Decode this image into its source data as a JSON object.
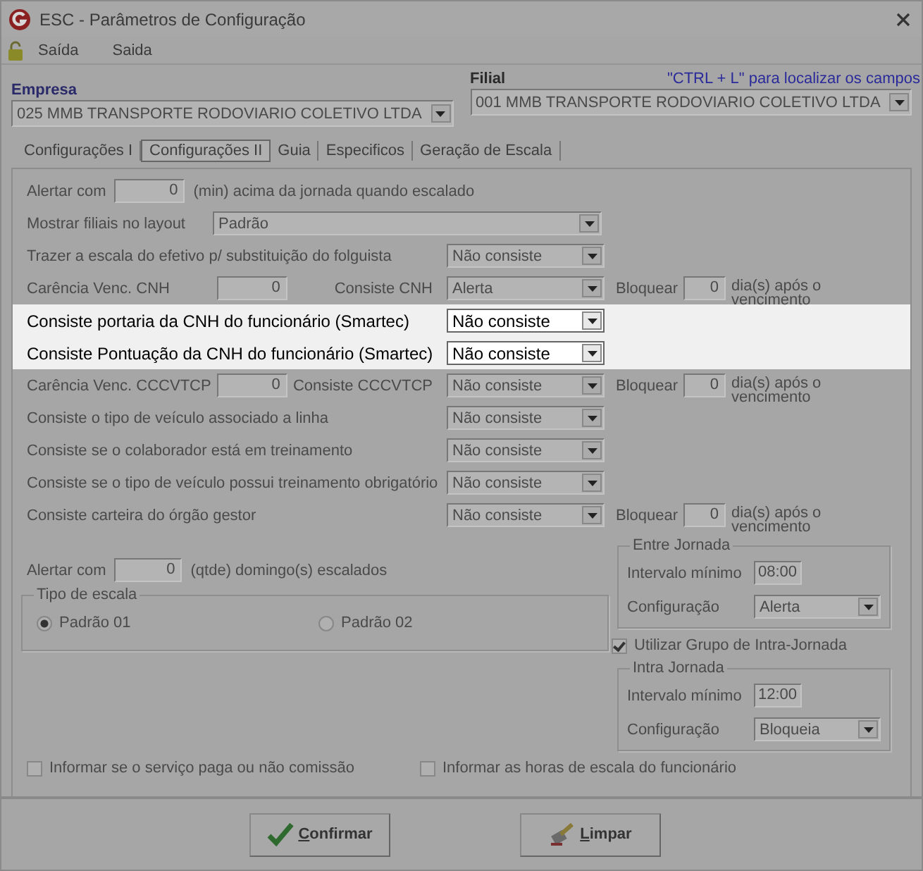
{
  "window": {
    "title": "ESC - Parâmetros de Configuração"
  },
  "menu": [
    "Saída",
    "Saida"
  ],
  "hint": "\"CTRL + L\" para localizar os campos",
  "empresa": {
    "label": "Empresa",
    "value": "025 MMB TRANSPORTE RODOVIARIO COLETIVO LTDA"
  },
  "filial": {
    "label": "Filial",
    "value": "001 MMB TRANSPORTE RODOVIARIO COLETIVO LTDA"
  },
  "tabs": [
    {
      "label": "Configurações I",
      "selected": false
    },
    {
      "label": "Configurações II",
      "selected": true
    },
    {
      "label": "Guia",
      "selected": false
    },
    {
      "label": "Especificos",
      "selected": false
    },
    {
      "label": "Geração de Escala",
      "selected": false
    }
  ],
  "rows": [
    {
      "kind": "number",
      "label": "Alertar com",
      "value": "0",
      "suffix": "(min) acima da jornada quando escalado",
      "highlighted": false
    },
    {
      "kind": "wide",
      "label": "Mostrar filiais no layout",
      "select": "Padrão",
      "highlighted": false
    },
    {
      "kind": "select",
      "label": "Trazer a escala do efetivo p/ substituição do folguista",
      "select": "Não consiste",
      "highlighted": false
    },
    {
      "kind": "carencia",
      "label": "Carência Venc. CNH",
      "value": "0",
      "label2": "Consiste CNH",
      "select": "Alerta",
      "block_label": "Bloquear",
      "block_value": "0",
      "block_suffix": "dia(s) após o vencimento",
      "highlighted": false
    },
    {
      "kind": "select",
      "label": "Consiste portaria da CNH do funcionário (Smartec)",
      "select": "Não consiste",
      "highlighted": true
    },
    {
      "kind": "select",
      "label": "Consiste Pontuação da CNH do funcionário (Smartec)",
      "select": "Não consiste",
      "highlighted": true
    },
    {
      "kind": "carencia",
      "label": "Carência Venc. CCCVTCP",
      "value": "0",
      "label2": "Consiste CCCVTCP",
      "select": "Não consiste",
      "block_label": "Bloquear",
      "block_value": "0",
      "block_suffix": "dia(s) após o vencimento",
      "highlighted": false
    },
    {
      "kind": "select",
      "label": "Consiste o tipo de veículo associado a linha",
      "select": "Não consiste",
      "highlighted": false
    },
    {
      "kind": "select",
      "label": "Consiste se o colaborador está em treinamento",
      "select": "Não consiste",
      "highlighted": false
    },
    {
      "kind": "select",
      "label": "Consiste se o tipo de veículo possui treinamento obrigatório",
      "select": "Não consiste",
      "highlighted": false
    },
    {
      "kind": "select_block",
      "label": "Consiste carteira do órgão gestor",
      "select": "Não consiste",
      "block_label": "Bloquear",
      "block_value": "0",
      "block_suffix": "dia(s) após o vencimento",
      "highlighted": false
    }
  ],
  "sundays": {
    "label": "Alertar com",
    "value": "0",
    "suffix": "(qtde) domingo(s) escalados"
  },
  "tipo_escala": {
    "title": "Tipo de escala",
    "options": [
      {
        "label": "Padrão 01",
        "selected": true
      },
      {
        "label": "Padrão 02",
        "selected": false
      }
    ]
  },
  "entre_jornada": {
    "title": "Entre Jornada",
    "interval_label": "Intervalo mínimo",
    "interval": "08:00",
    "config_label": "Configuração",
    "config": "Alerta"
  },
  "intra_checkbox": {
    "label": "Utilizar Grupo de Intra-Jornada",
    "checked": true
  },
  "intra_jornada": {
    "title": "Intra Jornada",
    "interval_label": "Intervalo mínimo",
    "interval": "12:00",
    "config_label": "Configuração",
    "config": "Bloqueia"
  },
  "bottom_checks": [
    {
      "label": "Informar se o serviço paga ou não comissão",
      "checked": false
    },
    {
      "label": "Informar as horas de escala do funcionário",
      "checked": false
    }
  ],
  "buttons": [
    {
      "kind": "confirm",
      "label": "Confirmar"
    },
    {
      "kind": "clear",
      "label": "Limpar"
    }
  ]
}
